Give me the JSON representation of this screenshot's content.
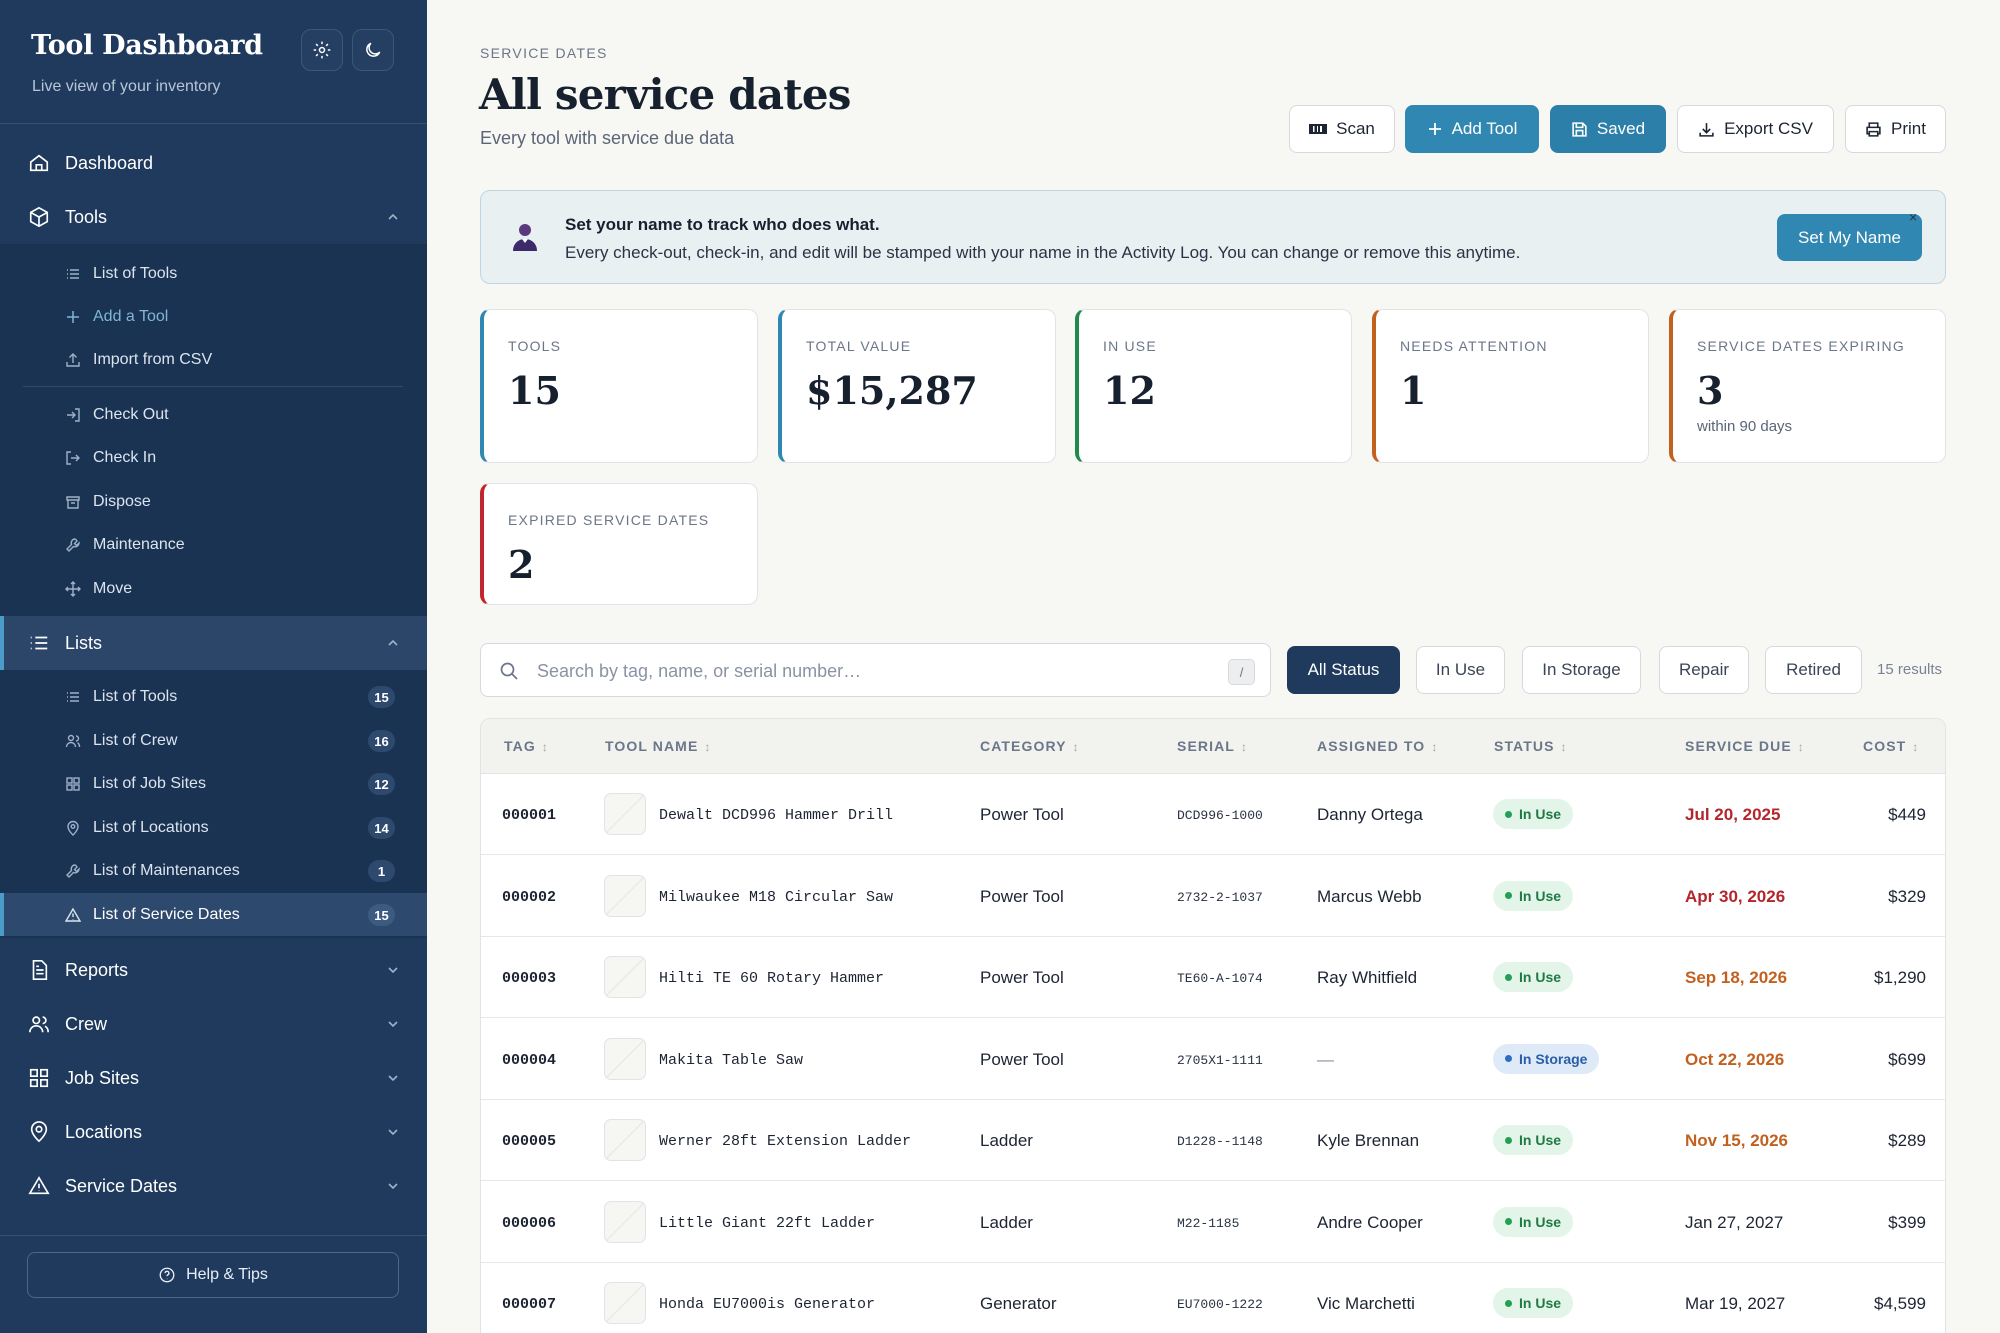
{
  "sidebar": {
    "brand": "Tool Dashboard",
    "brand_sub": "Live view of your inventory",
    "top": [
      {
        "label": "Dashboard",
        "icon": "home-icon"
      },
      {
        "label": "Tools",
        "icon": "box-icon"
      }
    ],
    "tools_items": [
      {
        "label": "List of Tools",
        "icon": "list-icon"
      },
      {
        "label": "Add a Tool",
        "icon": "plus-icon"
      },
      {
        "label": "Import from CSV",
        "icon": "upload-icon"
      },
      {
        "label": "Check Out",
        "icon": "login-icon"
      },
      {
        "label": "Check In",
        "icon": "logout-icon"
      },
      {
        "label": "Dispose",
        "icon": "archive-icon"
      },
      {
        "label": "Maintenance",
        "icon": "wrench-icon"
      },
      {
        "label": "Move",
        "icon": "move-icon"
      }
    ],
    "lists_label": "Lists",
    "lists_items": [
      {
        "label": "List of Tools",
        "count": "15",
        "icon": "list-icon"
      },
      {
        "label": "List of Crew",
        "count": "16",
        "icon": "users-icon"
      },
      {
        "label": "List of Job Sites",
        "count": "12",
        "icon": "grid-icon"
      },
      {
        "label": "List of Locations",
        "count": "14",
        "icon": "pin-icon"
      },
      {
        "label": "List of Maintenances",
        "count": "1",
        "icon": "wrench-icon"
      },
      {
        "label": "List of Service Dates",
        "count": "15",
        "icon": "warning-icon"
      }
    ],
    "bottom": [
      {
        "label": "Reports",
        "icon": "report-icon"
      },
      {
        "label": "Crew",
        "icon": "users-icon"
      },
      {
        "label": "Job Sites",
        "icon": "grid-icon"
      },
      {
        "label": "Locations",
        "icon": "pin-icon"
      },
      {
        "label": "Service Dates",
        "icon": "warning-icon"
      }
    ],
    "help": "Help & Tips"
  },
  "header": {
    "eyebrow": "SERVICE DATES",
    "title": "All service dates",
    "subtitle": "Every tool with service due data"
  },
  "toolbar": {
    "scan": "Scan",
    "add": "Add Tool",
    "saved": "Saved",
    "export": "Export CSV",
    "print": "Print"
  },
  "banner": {
    "title": "Set your name to track who does what.",
    "body": "Every check-out, check-in, and edit will be stamped with your name in the Activity Log. You can change or remove this anytime.",
    "button": "Set My Name",
    "close": "×"
  },
  "stats": [
    {
      "label": "TOOLS",
      "value": "15",
      "note": "",
      "accent": "#2f87b2"
    },
    {
      "label": "TOTAL VALUE",
      "value": "$15,287",
      "note": "",
      "accent": "#2f87b2"
    },
    {
      "label": "IN USE",
      "value": "12",
      "note": "",
      "accent": "#1f8a4c"
    },
    {
      "label": "NEEDS ATTENTION",
      "value": "1",
      "note": "",
      "accent": "#c2611f"
    },
    {
      "label": "SERVICE DATES EXPIRING",
      "value": "3",
      "note": "within 90 days",
      "accent": "#c2611f"
    },
    {
      "label": "EXPIRED SERVICE DATES",
      "value": "2",
      "note": "",
      "accent": "#c0262d"
    }
  ],
  "search": {
    "placeholder": "Search by tag, name, or serial number…",
    "shortcut": "/"
  },
  "filters": [
    "All Status",
    "In Use",
    "In Storage",
    "Repair",
    "Retired"
  ],
  "results": "15 results",
  "table": {
    "columns": [
      "TAG",
      "TOOL NAME",
      "CATEGORY",
      "SERIAL",
      "ASSIGNED TO",
      "STATUS",
      "SERVICE DUE",
      "COST"
    ],
    "rows": [
      {
        "tag": "000001",
        "name": "Dewalt DCD996 Hammer Drill",
        "category": "Power Tool",
        "serial": "DCD996-1000",
        "assigned": "Danny Ortega",
        "status": "In Use",
        "due": "Jul 20, 2025",
        "due_color": "#b3262b",
        "cost": "$449"
      },
      {
        "tag": "000002",
        "name": "Milwaukee M18 Circular Saw",
        "category": "Power Tool",
        "serial": "2732-2-1037",
        "assigned": "Marcus Webb",
        "status": "In Use",
        "due": "Apr 30, 2026",
        "due_color": "#b3262b",
        "cost": "$329"
      },
      {
        "tag": "000003",
        "name": "Hilti TE 60 Rotary Hammer",
        "category": "Power Tool",
        "serial": "TE60-A-1074",
        "assigned": "Ray Whitfield",
        "status": "In Use",
        "due": "Sep 18, 2026",
        "due_color": "#c2611f",
        "cost": "$1,290"
      },
      {
        "tag": "000004",
        "name": "Makita Table Saw",
        "category": "Power Tool",
        "serial": "2705X1-1111",
        "assigned": "—",
        "status": "In Storage",
        "due": "Oct 22, 2026",
        "due_color": "#c2611f",
        "cost": "$699"
      },
      {
        "tag": "000005",
        "name": "Werner 28ft Extension Ladder",
        "category": "Ladder",
        "serial": "D1228--1148",
        "assigned": "Kyle Brennan",
        "status": "In Use",
        "due": "Nov 15, 2026",
        "due_color": "#c2611f",
        "cost": "$289"
      },
      {
        "tag": "000006",
        "name": "Little Giant 22ft Ladder",
        "category": "Ladder",
        "serial": "M22-1185",
        "assigned": "Andre Cooper",
        "status": "In Use",
        "due": "Jan 27, 2027",
        "due_color": "#1d2433",
        "cost": "$399"
      },
      {
        "tag": "000007",
        "name": "Honda EU7000is Generator",
        "category": "Generator",
        "serial": "EU7000-1222",
        "assigned": "Vic Marchetti",
        "status": "In Use",
        "due": "Mar 19, 2027",
        "due_color": "#1d2433",
        "cost": "$4,599"
      }
    ]
  }
}
